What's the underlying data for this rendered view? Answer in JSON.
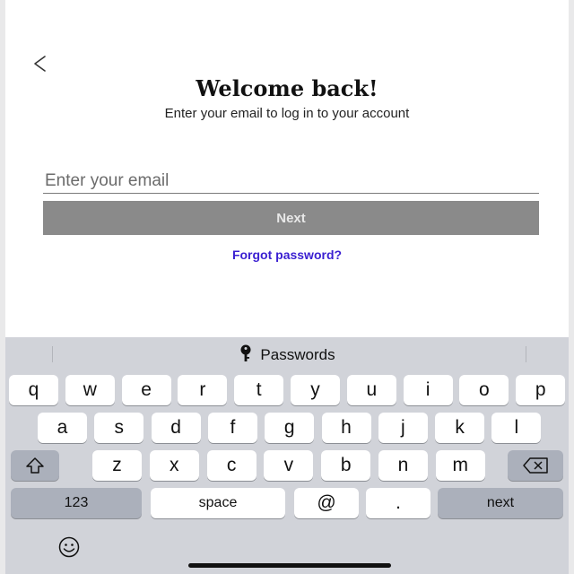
{
  "header": {
    "title": "Welcome back!",
    "subtitle": "Enter your email to log in to your account"
  },
  "form": {
    "email_placeholder": "Enter your email",
    "email_value": "",
    "next_label": "Next",
    "forgot_label": "Forgot password?"
  },
  "keyboard": {
    "passwords_label": "Passwords",
    "row1": [
      "q",
      "w",
      "e",
      "r",
      "t",
      "y",
      "u",
      "i",
      "o",
      "p"
    ],
    "row2": [
      "a",
      "s",
      "d",
      "f",
      "g",
      "h",
      "j",
      "k",
      "l"
    ],
    "row3": [
      "z",
      "x",
      "c",
      "v",
      "b",
      "n",
      "m"
    ],
    "numbers_label": "123",
    "space_label": "space",
    "at_label": "@",
    "dot_label": ".",
    "next_label": "next"
  },
  "colors": {
    "link": "#3a1fd1",
    "next_button_bg": "#8a8a8a",
    "keyboard_bg": "#d1d3d9"
  }
}
